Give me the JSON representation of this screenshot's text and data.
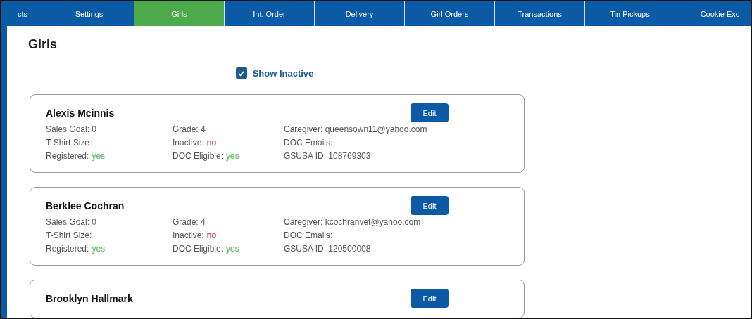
{
  "tabs": [
    {
      "label": "cts",
      "selected": false
    },
    {
      "label": "Settings",
      "selected": false
    },
    {
      "label": "Girls",
      "selected": true
    },
    {
      "label": "Int. Order",
      "selected": false
    },
    {
      "label": "Delivery",
      "selected": false
    },
    {
      "label": "Girl Orders",
      "selected": false
    },
    {
      "label": "Transactions",
      "selected": false
    },
    {
      "label": "Tin Pickups",
      "selected": false
    },
    {
      "label": "Cookie Exc",
      "selected": false
    }
  ],
  "page_title": "Girls",
  "show_inactive": {
    "label": "Show Inactive",
    "checked": true
  },
  "girls": [
    {
      "name": "Alexis Mcinnis",
      "edit_button": "Edit",
      "columns": [
        [
          {
            "label": "Sales Goal: 0"
          },
          {
            "label": "T-Shirt Size:"
          },
          {
            "label": "Registered:",
            "value": "yes",
            "color": "#6cbf6c"
          }
        ],
        [
          {
            "label": "Grade: 4"
          },
          {
            "label": "Inactive:",
            "value": "no",
            "color": "#e0406a"
          },
          {
            "label": "DOC Eligible:",
            "value": "yes",
            "color": "#6cbf6c"
          }
        ],
        [
          {
            "label": "Caregiver: queensown11@yahoo.com"
          },
          {
            "label": "DOC Emails:"
          },
          {
            "label": "GSUSA ID: 108769303"
          }
        ]
      ]
    },
    {
      "name": "Berklee Cochran",
      "edit_button": "Edit",
      "columns": [
        [
          {
            "label": "Sales Goal: 0"
          },
          {
            "label": "T-Shirt Size:"
          },
          {
            "label": "Registered:",
            "value": "yes",
            "color": "#6cbf6c"
          }
        ],
        [
          {
            "label": "Grade: 4"
          },
          {
            "label": "Inactive:",
            "value": "no",
            "color": "#e0406a"
          },
          {
            "label": "DOC Eligible:",
            "value": "yes",
            "color": "#6cbf6c"
          }
        ],
        [
          {
            "label": "Caregiver: kcochranvet@yahoo.com"
          },
          {
            "label": "DOC Emails:"
          },
          {
            "label": "GSUSA ID: 120500008"
          }
        ]
      ]
    },
    {
      "name": "Brooklyn Hallmark",
      "edit_button": "Edit"
    }
  ]
}
